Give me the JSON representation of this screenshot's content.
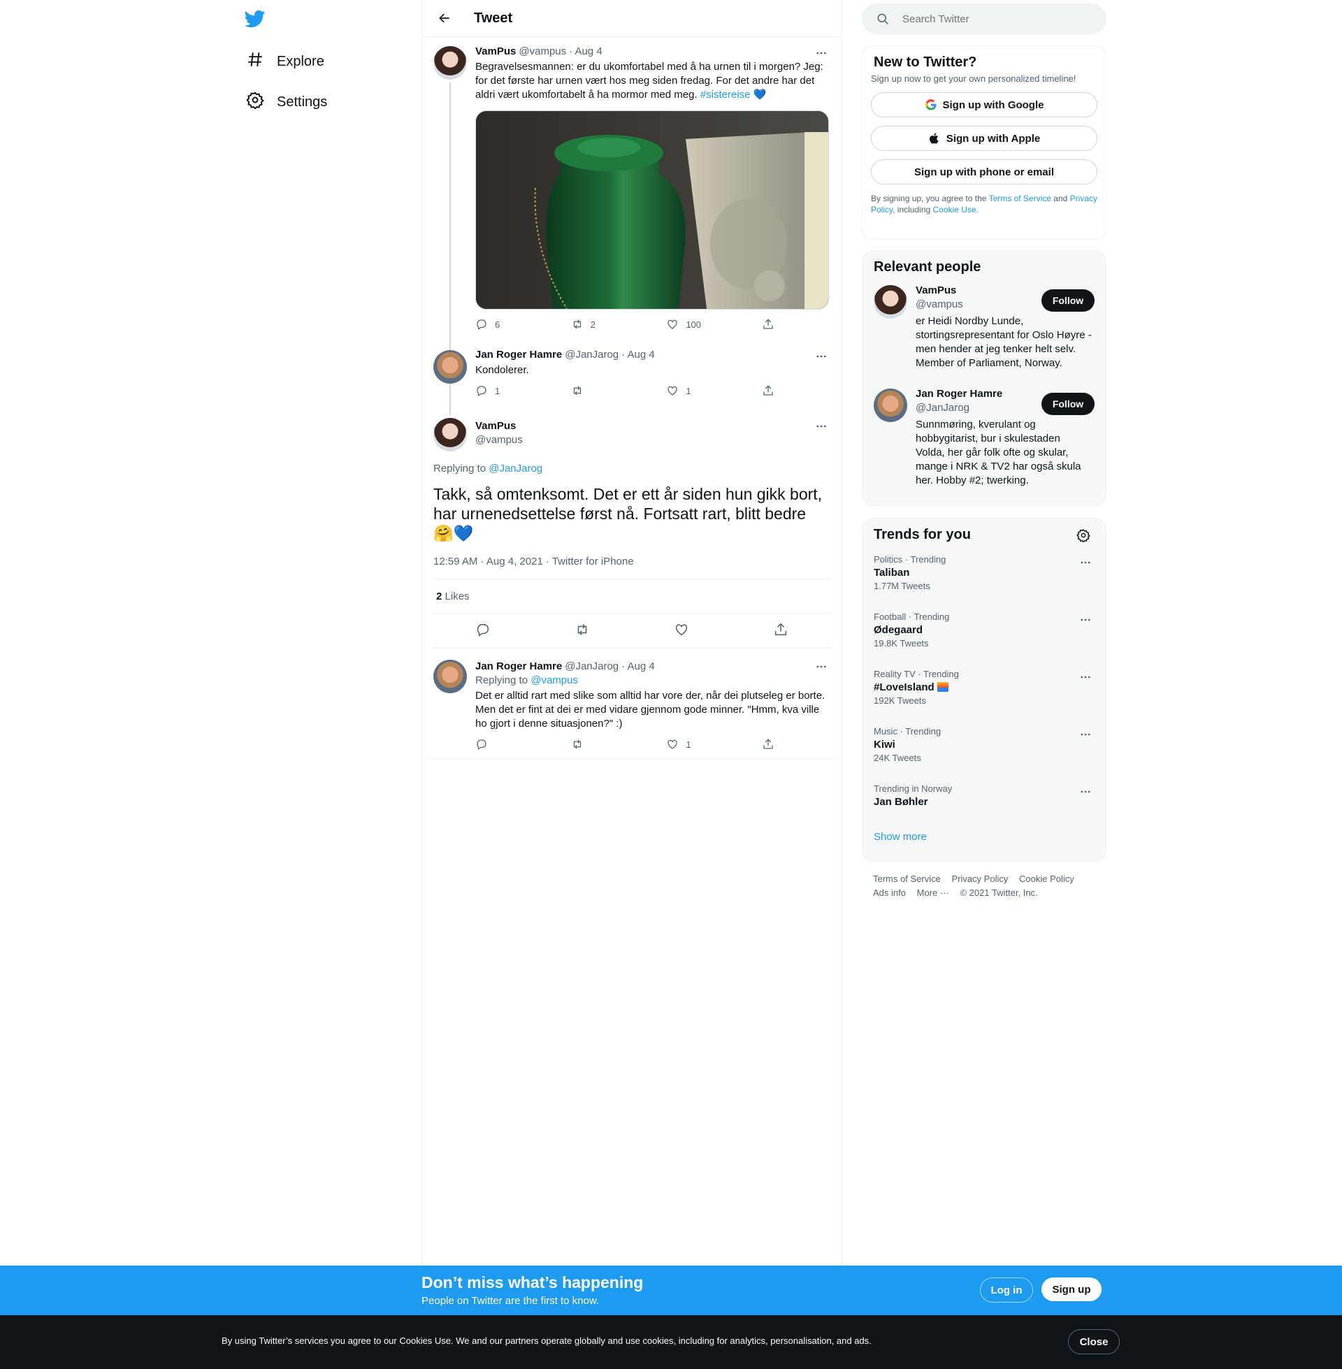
{
  "colors": {
    "accent": "#1d9bf0",
    "text": "#0f1419",
    "muted": "#536471",
    "border": "#eff3f4",
    "heart": "#5aa8e6"
  },
  "nav": {
    "items": [
      {
        "label": "Explore",
        "icon": "hashtag-icon"
      },
      {
        "label": "Settings",
        "icon": "gear-icon"
      }
    ]
  },
  "header": {
    "title": "Tweet"
  },
  "thread": [
    {
      "name": "VamPus",
      "handle": "@vampus",
      "date": "· Aug 4",
      "text": "Begravelsesmannen: er du ukomfortabel med å ha urnen til i morgen? Jeg: for det første har urnen vært hos meg siden fredag. For det andre har det aldri vært ukomfortabelt å ha mormor med meg.",
      "hashtag": "#sistereise",
      "emoji": "💙",
      "replies": "6",
      "retweets": "2",
      "likes": "100"
    },
    {
      "name": "Jan Roger Hamre",
      "handle": "@JanJarog",
      "date": "· Aug 4",
      "text": "Kondolerer.",
      "replies": "1",
      "retweets": "",
      "likes": "1"
    }
  ],
  "main": {
    "name": "VamPus",
    "handle": "@vampus",
    "replying_label": "Replying to",
    "replying_to": "@JanJarog",
    "text": "Takk, så omtenksomt. Det er ett år siden hun gikk bort, har urnenedsettelse først nå. Fortsatt rart, blitt bedre 🤗💙",
    "meta": "12:59 AM · Aug 4, 2021 · Twitter for iPhone",
    "likes_count": "2",
    "likes_label": "Likes"
  },
  "reply": {
    "name": "Jan Roger Hamre",
    "handle": "@JanJarog",
    "date": "· Aug 4",
    "replying_label": "Replying to",
    "replying_to": "@vampus",
    "text": "Det er alltid rart med slike som alltid har vore der, når dei plutseleg er borte. Men det er fint at dei er med vidare gjennom gode minner. \"Hmm, kva ville ho gjort i denne situasjonen?\" :)",
    "replies": "",
    "retweets": "",
    "likes": "1"
  },
  "search": {
    "placeholder": "Search Twitter"
  },
  "signup": {
    "title": "New to Twitter?",
    "subtitle": "Sign up now to get your own personalized timeline!",
    "google": "Sign up with Google",
    "apple": "Sign up with Apple",
    "phone": "Sign up with phone or email",
    "legal_1": "By signing up, you agree to the",
    "terms": "Terms of Service",
    "legal_2": "and",
    "privacy": "Privacy Policy",
    "legal_3": ", including",
    "cookie": "Cookie Use."
  },
  "people": {
    "title": "Relevant people",
    "follow_label": "Follow",
    "items": [
      {
        "name": "VamPus",
        "handle": "@vampus",
        "bio": "er Heidi Nordby Lunde, stortingsrepresentant for Oslo Høyre - men hender at jeg tenker helt selv. Member of Parliament, Norway."
      },
      {
        "name": "Jan Roger Hamre",
        "handle": "@JanJarog",
        "bio": "Sunnmøring, kverulant og hobbygitarist, bur i skulestaden Volda, her går folk ofte og skular, mange i NRK & TV2 har også skula her. Hobby #2; twerking."
      }
    ]
  },
  "trends": {
    "title": "Trends for you",
    "items": [
      {
        "category": "Politics · Trending",
        "name": "Taliban",
        "count": "1.77M Tweets"
      },
      {
        "category": "Football · Trending",
        "name": "Ødegaard",
        "count": "19.8K Tweets"
      },
      {
        "category": "Reality TV · Trending",
        "name": "#LoveIsland",
        "count": "192K Tweets"
      },
      {
        "category": "Music · Trending",
        "name": "Kiwi",
        "count": "24K Tweets"
      },
      {
        "category": "Trending in Norway",
        "name": "Jan Bøhler",
        "count": ""
      }
    ],
    "show_more": "Show more"
  },
  "footer": {
    "terms": "Terms of Service",
    "privacy": "Privacy Policy",
    "cookie": "Cookie Policy",
    "ads": "Ads info",
    "more": "More ···",
    "copyright": "© 2021 Twitter, Inc."
  },
  "bottom_bar": {
    "title": "Don’t miss what’s happening",
    "subtitle": "People on Twitter are the first to know.",
    "login": "Log in",
    "signup": "Sign up"
  },
  "cookie_bar": {
    "text": "By using Twitter’s services you agree to our Cookies Use. We and our partners operate globally and use cookies, including for analytics, personalisation, and ads.",
    "close": "Close"
  }
}
